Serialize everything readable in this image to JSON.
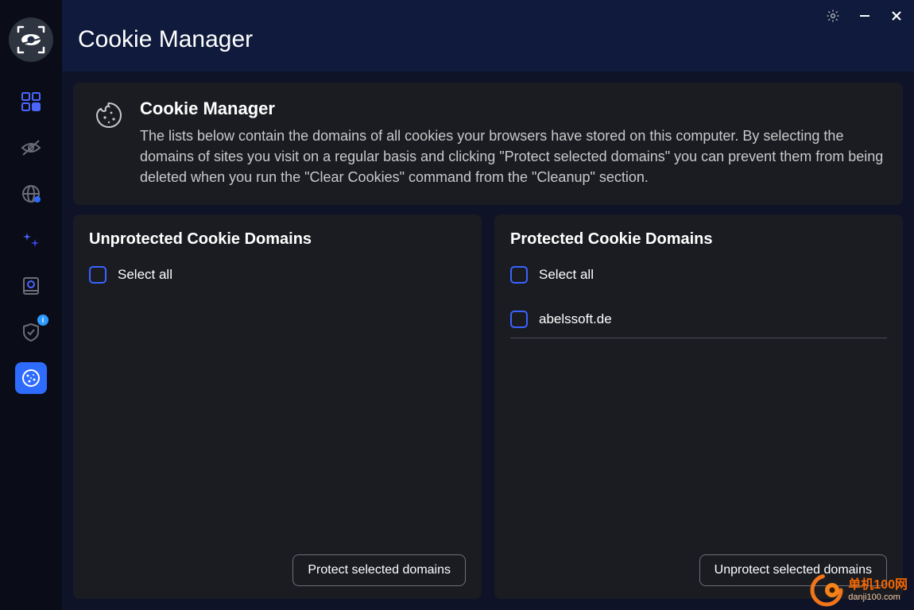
{
  "header": {
    "title": "Cookie Manager"
  },
  "intro": {
    "heading": "Cookie Manager",
    "body": "The lists below contain the domains of all cookies your browsers have stored on this computer. By selecting the domains of sites you visit on a regular basis and clicking \"Protect selected domains\" you can prevent them from being deleted when you run the \"Clear Cookies\" command from the \"Cleanup\" section."
  },
  "sidebar": {
    "nav_items": [
      {
        "id": "dashboard",
        "label": "Dashboard"
      },
      {
        "id": "privacy",
        "label": "Privacy"
      },
      {
        "id": "web",
        "label": "Web Protection"
      },
      {
        "id": "cleanup",
        "label": "Cleanup"
      },
      {
        "id": "scan",
        "label": "Scan"
      },
      {
        "id": "shield",
        "label": "Shield",
        "badge": "i"
      },
      {
        "id": "cookie-manager",
        "label": "Cookie Manager",
        "active": true
      }
    ]
  },
  "unprotected": {
    "title": "Unprotected Cookie Domains",
    "select_all_label": "Select all",
    "items": [],
    "action_label": "Protect selected domains"
  },
  "protected": {
    "title": "Protected Cookie Domains",
    "select_all_label": "Select all",
    "items": [
      {
        "domain": "abelssoft.de",
        "selected": false
      }
    ],
    "action_label": "Unprotect selected domains"
  },
  "watermark": {
    "line1": "单机100网",
    "line2": "danji100.com"
  }
}
